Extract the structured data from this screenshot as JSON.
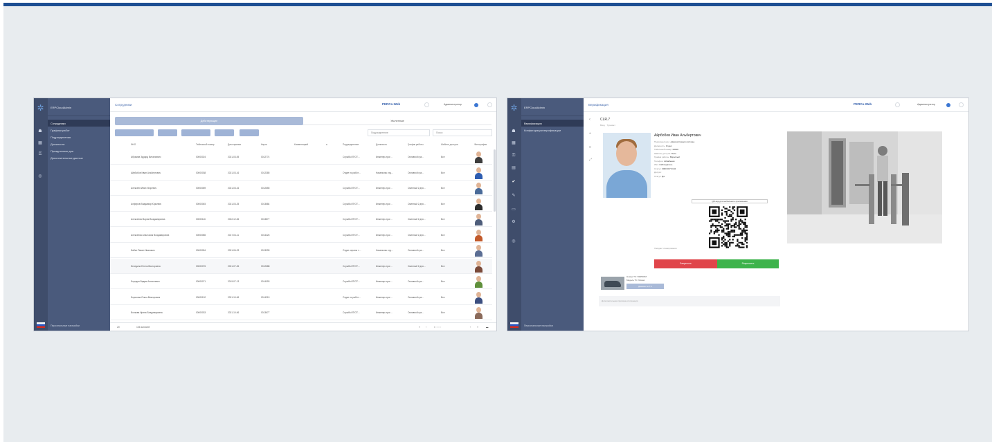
{
  "employees_window": {
    "app_name": "ERPCloudAdmin",
    "sidebar": {
      "items": [
        {
          "label": "Сотрудники"
        },
        {
          "label": "Графики работ"
        },
        {
          "label": "Подразделения"
        },
        {
          "label": "Должности"
        },
        {
          "label": "Праздничные дни"
        },
        {
          "label": "Дополнительные данные"
        }
      ],
      "footer_label": "Персональные настройки"
    },
    "topbar": {
      "title": "Сотрудники",
      "brand": "PERCo-Web",
      "user": "Администратор"
    },
    "tabs": [
      "Действующие",
      "Уволенные"
    ],
    "filters": {
      "division_placeholder": "Подразделение",
      "search_placeholder": "Поиск"
    },
    "table": {
      "columns": [
        "ФИО",
        "Табельный номер",
        "Дата приема",
        "Карта",
        "Комментарий",
        "Подразделение",
        "Должность",
        "График работы",
        "Шаблон доступа",
        "Фотография"
      ],
      "rows": [
        {
          "name": "Абрамов Эдуард Витальевич",
          "tab": "00000024",
          "date": "2021-03-05",
          "card": "0012774",
          "division": "Служба ИТ/ОТ…",
          "position": "Инженер-прог…",
          "schedule": "Основной гра…",
          "access": "Все"
        },
        {
          "name": "Айрбобов Иван Альбертович",
          "tab": "00000038",
          "date": "2021-03-16",
          "card": "0012385",
          "division": "Отдел по работ…",
          "position": "Начальник отд…",
          "schedule": "Основной гра…",
          "access": "Все"
        },
        {
          "name": "Алексеев Иван Игоревич",
          "tab": "00000069",
          "date": "2021-03-16",
          "card": "0012655",
          "division": "Служба ИТ/ОТ…",
          "position": "Инженер-прог…",
          "schedule": "Сменный 2 дня…",
          "access": "Все"
        },
        {
          "name": "Алферов Владимир Юрьевич",
          "tab": "00000045",
          "date": "2021-03-25",
          "card": "0013684",
          "division": "Служба ИТ/ОТ…",
          "position": "Инженер-прог…",
          "schedule": "Сменный 2 дня…",
          "access": "Все"
        },
        {
          "name": "Алексеева Мария Владимировна",
          "tab": "00000116",
          "date": "2022-12-06",
          "card": "0013877",
          "division": "Служба ИТ/ОТ…",
          "position": "Инженер-прог…",
          "schedule": "Сменный 2 дня…",
          "access": "Все"
        },
        {
          "name": "Алексеева Анастасия Владимировна",
          "tab": "00000085",
          "date": "2017-04-11",
          "card": "0014426",
          "division": "Служба ИТ/ОТ…",
          "position": "Инженер-прог…",
          "schedule": "Сменный 2 дня…",
          "access": "Все"
        },
        {
          "name": "Бабин Павел Иванович",
          "tab": "00000054",
          "date": "2021-06-23",
          "card": "0013095",
          "division": "Отдел охраны т…",
          "position": "Начальник отд…",
          "schedule": "Основной гра…",
          "access": "Все"
        },
        {
          "name": "Беседина Елена Викторовна",
          "tab": "00000076",
          "date": "2021-07-26",
          "card": "0012688",
          "division": "Служба ИТ/ОТ…",
          "position": "Инженер-прог…",
          "schedule": "Сменный 2 дня…",
          "access": "Все"
        },
        {
          "name": "Бородин Вадим Алексеевич",
          "tab": "00000071",
          "date": "2019-07-13",
          "card": "0014093",
          "division": "Служба ИТ/ОТ…",
          "position": "Инженер-прог…",
          "schedule": "Основной гра…",
          "access": "Все"
        },
        {
          "name": "Борисова Ольга Викторовна",
          "tab": "00000102",
          "date": "2021-10-06",
          "card": "0014215",
          "division": "Отдел по работ…",
          "position": "Инженер-прог…",
          "schedule": "Основной гра…",
          "access": "Все"
        },
        {
          "name": "Волкова Ирина Владимировна",
          "tab": "00000033",
          "date": "2021-10-06",
          "card": "0013677",
          "division": "Служба ИТ/ОТ…",
          "position": "Инженер-прог…",
          "schedule": "Основной гра…",
          "access": "Все"
        }
      ]
    },
    "pager": {
      "per_page": "20",
      "total": "136 записей"
    }
  },
  "verification_window": {
    "app_name": "ERPCloudAdmin",
    "sidebar": {
      "items": [
        {
          "label": "Верификация"
        },
        {
          "label": "Конфигурации верификации"
        }
      ],
      "footer_label": "Персональные настройки"
    },
    "topbar": {
      "title": "Верификация",
      "brand": "PERCo-Web",
      "user": "Администратор"
    },
    "point": {
      "title": "CLR.7",
      "subtitle": "Вход · Турникет"
    },
    "person": {
      "name": "Айрбобов Иван Альбертович",
      "fields": [
        {
          "label": "Подразделение:",
          "value": "Администрация системы"
        },
        {
          "label": "Должность:",
          "value": "Отдел"
        },
        {
          "label": "Табельный номер:",
          "value": "00000"
        },
        {
          "label": "Шаблон доступа:",
          "value": "Полн"
        },
        {
          "label": "График работы:",
          "value": "Взрослый"
        },
        {
          "label": "Телефон:",
          "value": "Айлабенов"
        },
        {
          "label": "Имя:",
          "value": "Наблюдатель"
        },
        {
          "label": "Статус:",
          "value": "0000 007 0104"
        },
        {
          "label": "Допуск:",
          "value": ""
        },
        {
          "label": "Статус:",
          "value": "Да"
        }
      ]
    },
    "qr_label": "QR-код для мобильного приложения",
    "qr_note": "Ожидает сканирования",
    "buttons": {
      "deny": "Запретить",
      "allow": "Разрешить"
    },
    "vehicle": {
      "line1": "Номер ТС: ВК459ХМ",
      "line2": "Модель ТС: Nissan",
      "button": "Данные по ТС"
    },
    "message": "Дополнительная причина отклонения"
  }
}
